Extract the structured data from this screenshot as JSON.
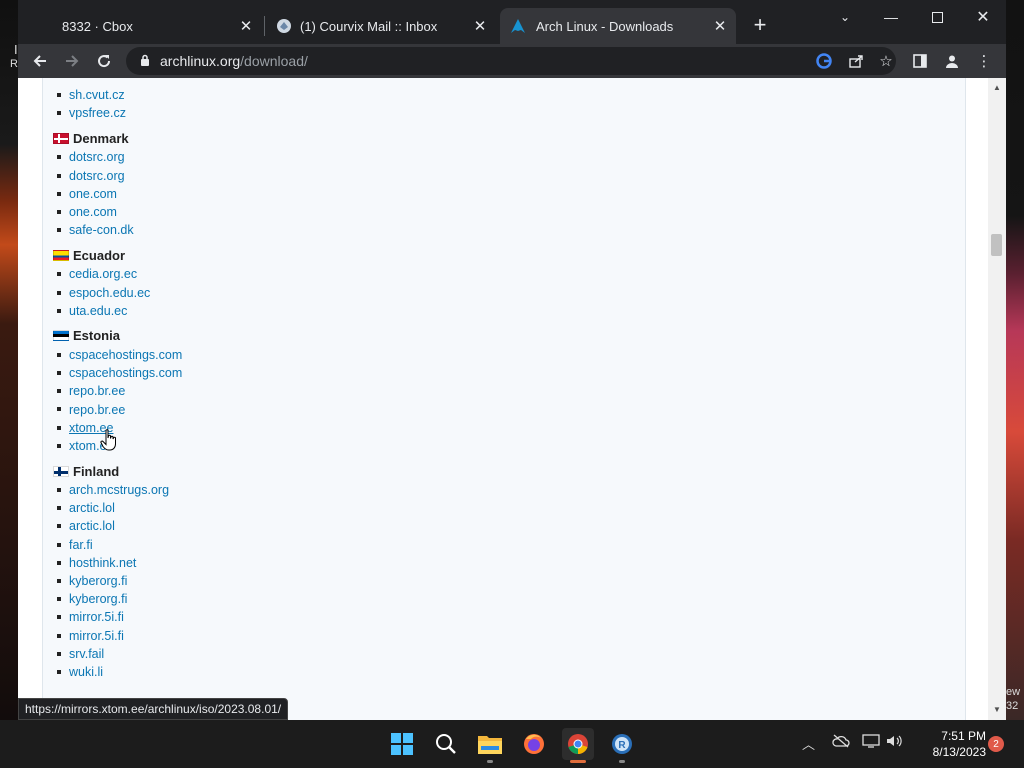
{
  "browser": {
    "tabs": [
      {
        "title": "8332 · Cbox",
        "icon": "cbox-icon",
        "active": false
      },
      {
        "title": "(1) Courvix Mail :: Inbox",
        "icon": "courvix-mail-icon",
        "active": false
      },
      {
        "title": "Arch Linux - Downloads",
        "icon": "arch-linux-icon",
        "active": true
      }
    ],
    "url_host": "archlinux.org",
    "url_path": "/download/",
    "status_url": "https://mirrors.xtom.ee/archlinux/iso/2023.08.01/"
  },
  "countries": [
    {
      "name": "",
      "mirrors": [
        "sh.cvut.cz",
        "vpsfree.cz"
      ]
    },
    {
      "name": "Denmark",
      "flag": "dk",
      "mirrors": [
        "dotsrc.org",
        "dotsrc.org",
        "one.com",
        "one.com",
        "safe-con.dk"
      ]
    },
    {
      "name": "Ecuador",
      "flag": "ec",
      "mirrors": [
        "cedia.org.ec",
        "espoch.edu.ec",
        "uta.edu.ec"
      ]
    },
    {
      "name": "Estonia",
      "flag": "ee",
      "mirrors": [
        "cspacehostings.com",
        "cspacehostings.com",
        "repo.br.ee",
        "repo.br.ee",
        "xtom.ee",
        "xtom.ee"
      ]
    },
    {
      "name": "Finland",
      "flag": "fi",
      "mirrors": [
        "arch.mcstrugs.org",
        "arctic.lol",
        "arctic.lol",
        "far.fi",
        "hosthink.net",
        "kyberorg.fi",
        "kyberorg.fi",
        "mirror.5i.fi",
        "mirror.5i.fi",
        "srv.fail",
        "wuki.li"
      ]
    }
  ],
  "hovered_link": "xtom.ee",
  "taskbar": {
    "apps": [
      "start-icon",
      "search-icon",
      "file-explorer-icon",
      "firefox-icon",
      "chrome-icon",
      "remote-app-icon"
    ],
    "time": "7:51 PM",
    "date": "8/13/2023",
    "notification_count": "2"
  },
  "desktop_fragments": {
    "left_top": "I",
    "left_second": "R",
    "right_a": "ew",
    "right_b": "32"
  },
  "colors": {
    "link": "#0b76b3",
    "page_bg": "#f6f9fc",
    "chrome_dark": "#202124",
    "chrome_toolbar": "#35363a"
  }
}
